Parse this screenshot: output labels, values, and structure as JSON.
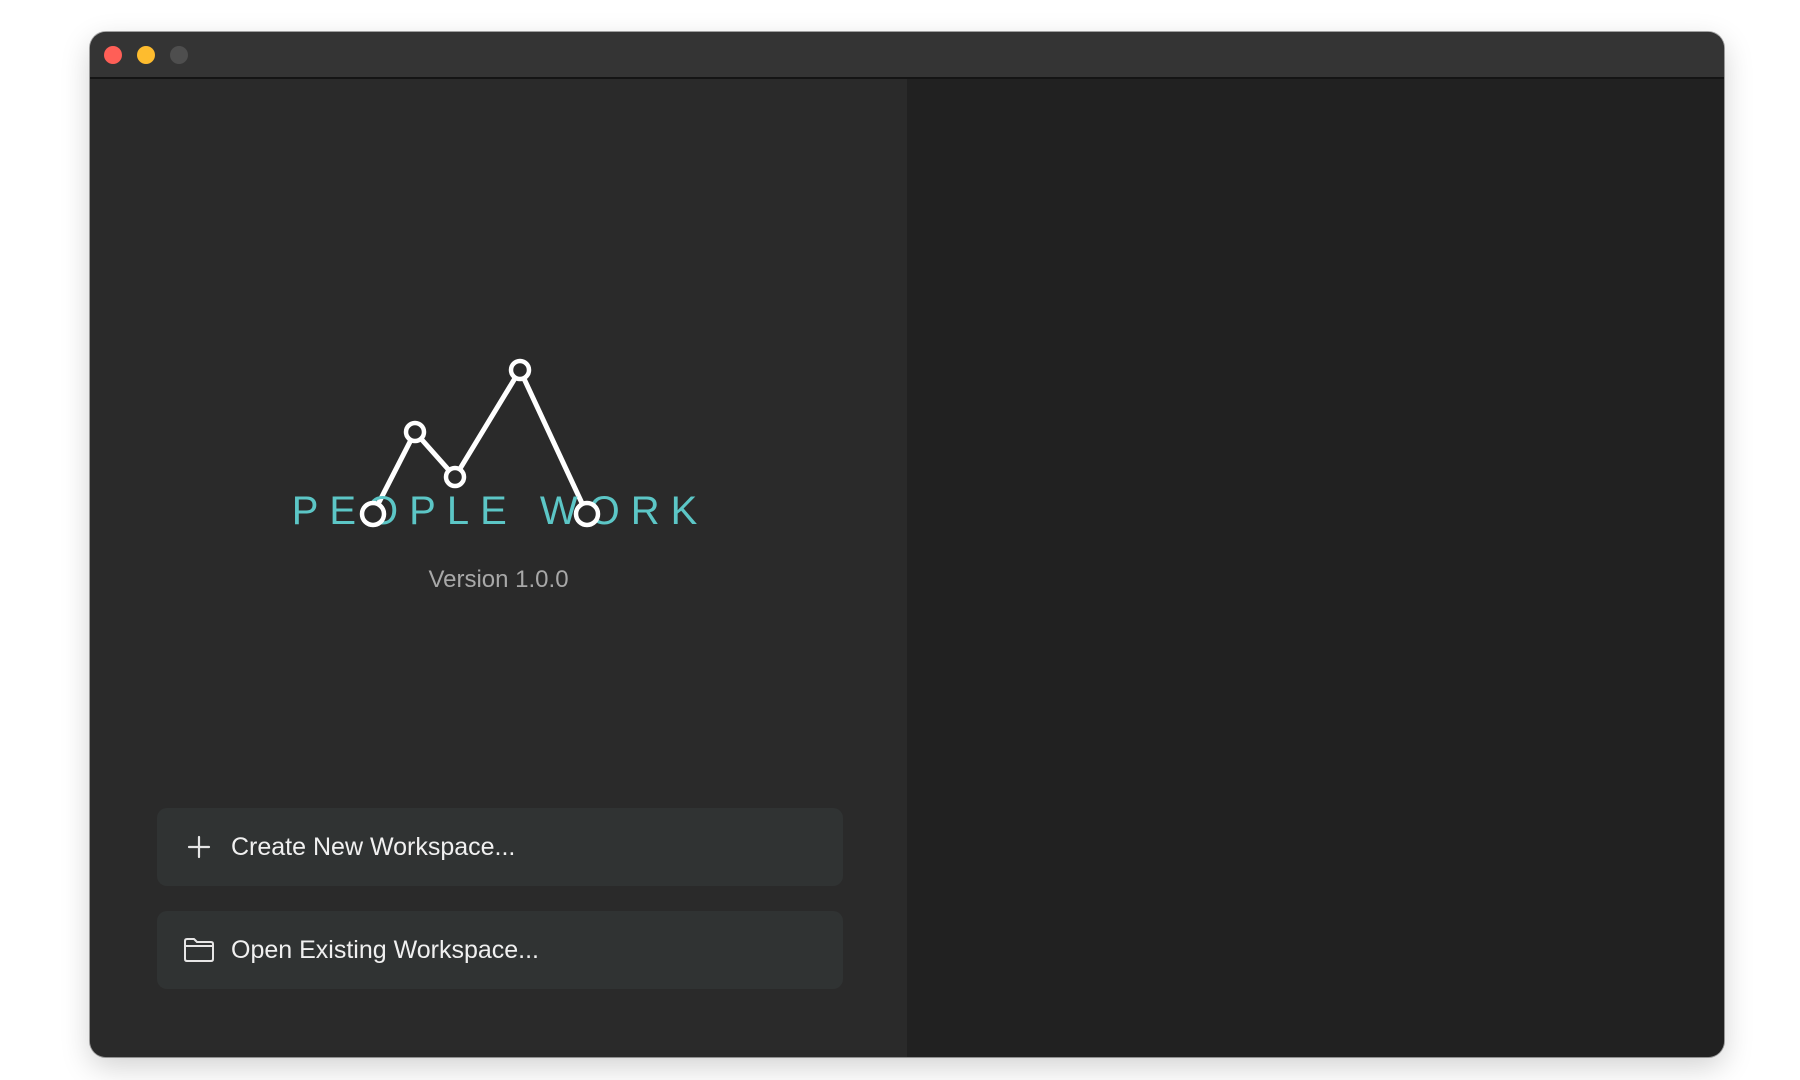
{
  "window": {
    "controls": {
      "close_color": "#ff5f57",
      "minimize_color": "#febc2e",
      "zoom_color": "#4e4e4e"
    }
  },
  "welcome": {
    "logo_text": "PEOPLE WORK",
    "logo_color": "#5cc6c6",
    "version": "Version 1.0.0",
    "actions": [
      {
        "label": "Create New Workspace...",
        "icon": "plus-icon"
      },
      {
        "label": "Open Existing Workspace...",
        "icon": "folder-icon"
      }
    ]
  }
}
